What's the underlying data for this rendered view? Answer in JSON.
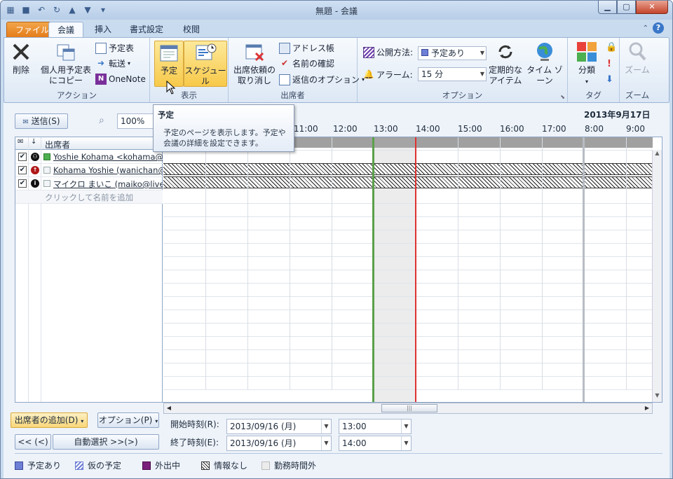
{
  "window": {
    "title": "無題 - 会議"
  },
  "tabs": [
    {
      "label": "ファイル"
    },
    {
      "label": "会議"
    },
    {
      "label": "挿入"
    },
    {
      "label": "書式設定"
    },
    {
      "label": "校閲"
    }
  ],
  "ribbon": {
    "action_group": {
      "label": "アクション",
      "delete": "削除",
      "copy_line1": "個人用予定表",
      "copy_line2": "にコピー",
      "calendar": "予定表",
      "forward": "転送",
      "onenote": "OneNote"
    },
    "display_group": {
      "label": "表示",
      "appointment": "予定",
      "schedule": "スケジュール"
    },
    "attendees_group": {
      "label": "出席者",
      "cancel_line1": "出席依頼の",
      "cancel_line2": "取り消し",
      "address_book": "アドレス帳",
      "check_names": "名前の確認",
      "response_options": "返信のオプション"
    },
    "options_group": {
      "label": "オプション",
      "show_as_label": "公開方法:",
      "show_as_value": "予定あり",
      "reminder_label": "アラーム:",
      "reminder_value": "15 分",
      "recurrence_line1": "定期的な",
      "recurrence_line2": "アイテム",
      "timezone": "タイム ゾーン"
    },
    "tags_group": {
      "label": "タグ",
      "categorize": "分類"
    },
    "zoom_group": {
      "label": "ズーム",
      "zoom": "ズーム"
    }
  },
  "scheduler": {
    "send_button": "送信(S)",
    "zoom_value": "100%",
    "date_header": "2013年9月17日",
    "times": [
      "11:00",
      "12:00",
      "13:00",
      "14:00",
      "15:00",
      "16:00",
      "17:00",
      "8:00",
      "9:00"
    ],
    "attendees_header": "出席者",
    "attendees": [
      {
        "name": "Yoshie Kohama <kohama@wan"
      },
      {
        "name": "Kohama Yoshie (wanichan@liv"
      },
      {
        "name": "マイクロ まいこ (maiko@live.jp)"
      }
    ],
    "add_placeholder": "クリックして名前を追加"
  },
  "bottom": {
    "add_attendees": "出席者の追加(D)",
    "options": "オプション(P)",
    "prev": "<< (<)",
    "autopick": "自動選択 >>(>)",
    "start_label": "開始時刻(R):",
    "start_date": "2013/09/16 (月)",
    "start_time": "13:00",
    "end_label": "終了時刻(E):",
    "end_date": "2013/09/16 (月)",
    "end_time": "14:00"
  },
  "legend": [
    {
      "label": "予定あり",
      "color": "#6e7fd6"
    },
    {
      "label": "仮の予定",
      "color": "#b8c2ee"
    },
    {
      "label": "外出中",
      "color": "#7a1f7a"
    },
    {
      "label": "情報なし",
      "color": "hatch"
    },
    {
      "label": "勤務時間外",
      "color": "#ececec"
    }
  ],
  "tooltip": {
    "title": "予定",
    "body_line1": "予定のページを表示します。予定や",
    "body_line2": "会議の詳細を設定できます。"
  }
}
